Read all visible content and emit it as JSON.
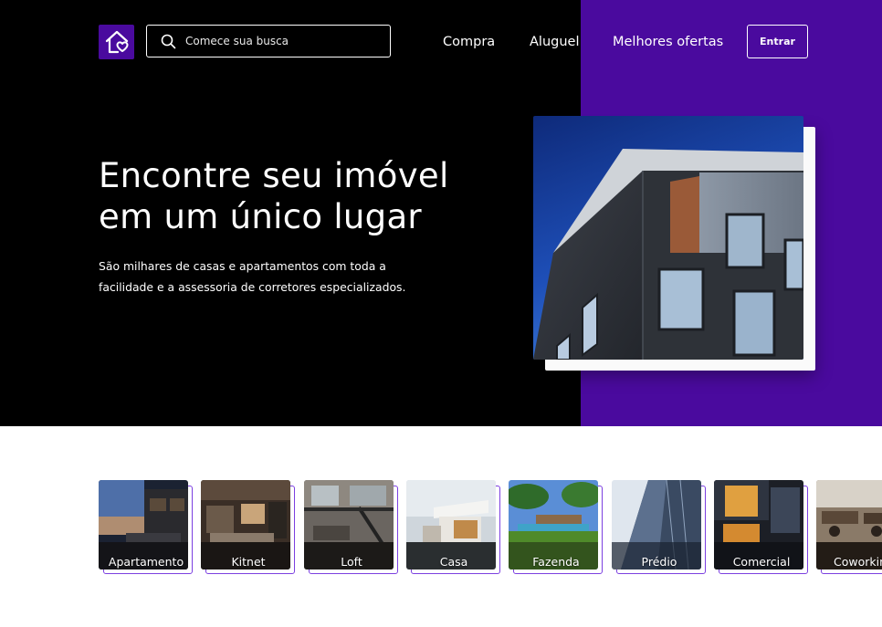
{
  "colors": {
    "primary": "#4a0a9e",
    "hero_background": "#000000",
    "text_on_dark": "#ffffff",
    "category_frame": "#7b3fe0"
  },
  "header": {
    "logo_icon": "house-heart-icon",
    "search": {
      "icon": "search-icon",
      "placeholder": "Comece sua busca"
    },
    "nav": {
      "compra": "Compra",
      "aluguel": "Aluguel",
      "ofertas": "Melhores ofertas"
    },
    "login_label": "Entrar"
  },
  "hero": {
    "title_line1": "Encontre seu imóvel",
    "title_line2": "em um único lugar",
    "subtitle_line1": "São milhares de casas e apartamentos com toda a",
    "subtitle_line2": "facilidade e a assessoria de corretores especializados."
  },
  "categories": [
    {
      "label": "Apartamento"
    },
    {
      "label": "Kitnet"
    },
    {
      "label": "Loft"
    },
    {
      "label": "Casa"
    },
    {
      "label": "Fazenda"
    },
    {
      "label": "Prédio"
    },
    {
      "label": "Comercial"
    },
    {
      "label": "Coworking"
    }
  ]
}
